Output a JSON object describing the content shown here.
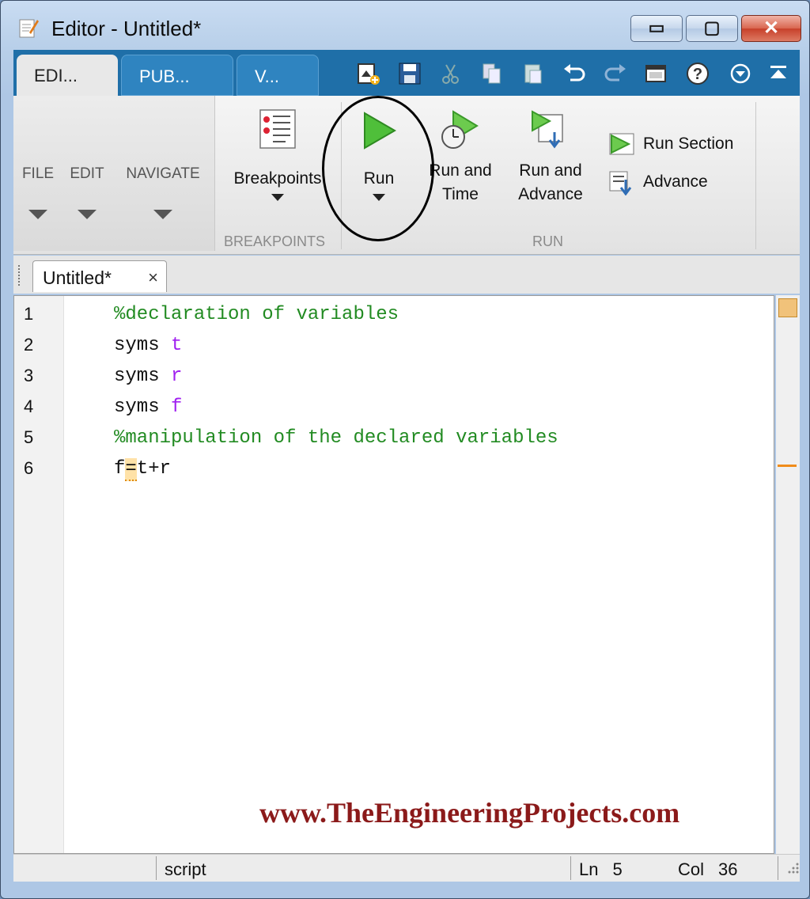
{
  "window": {
    "title": "Editor - Untitled*"
  },
  "window_controls": {
    "minimize": "▭",
    "maximize": "▢",
    "close": "✕"
  },
  "tabs": [
    {
      "label": "EDI...",
      "active": true
    },
    {
      "label": "PUB..."
    },
    {
      "label": "V..."
    }
  ],
  "quick_access": [
    "new-icon",
    "save-icon",
    "cut-icon",
    "copy-icon",
    "paste-icon",
    "undo-icon",
    "redo-icon",
    "window-icon",
    "help-icon",
    "options-icon",
    "minimize-ribbon-icon"
  ],
  "ribbon": {
    "file": "FILE",
    "edit": "EDIT",
    "navigate": "NAVIGATE",
    "breakpoints": {
      "label": "Breakpoints",
      "section": "BREAKPOINTS"
    },
    "run": {
      "section": "RUN",
      "run_label": "Run",
      "run_time_line1": "Run and",
      "run_time_line2": "Time",
      "run_adv_line1": "Run and",
      "run_adv_line2": "Advance",
      "run_section": "Run Section",
      "advance": "Advance"
    }
  },
  "document": {
    "tab_name": "Untitled*",
    "tab_close": "×"
  },
  "code_lines": [
    {
      "num": "1",
      "text": "%declaration of variables"
    },
    {
      "num": "2",
      "kw": "syms ",
      "var": "t"
    },
    {
      "num": "3",
      "kw": "syms ",
      "var": "r"
    },
    {
      "num": "4",
      "kw": "syms ",
      "var": "f"
    },
    {
      "num": "5",
      "text": "%manipulation of the declared variables"
    },
    {
      "num": "6",
      "pre": "f",
      "hl": "=",
      "post": "t+r"
    }
  ],
  "watermark": "www.TheEngineeringProjects.com",
  "status": {
    "mode": "script",
    "ln_label": "Ln",
    "ln": "5",
    "col_label": "Col",
    "col": "36"
  },
  "colors": {
    "comment": "#228b22",
    "symbol": "#a020f0",
    "tab_row": "#1f6fa8",
    "watermark": "#8b1a1a"
  }
}
